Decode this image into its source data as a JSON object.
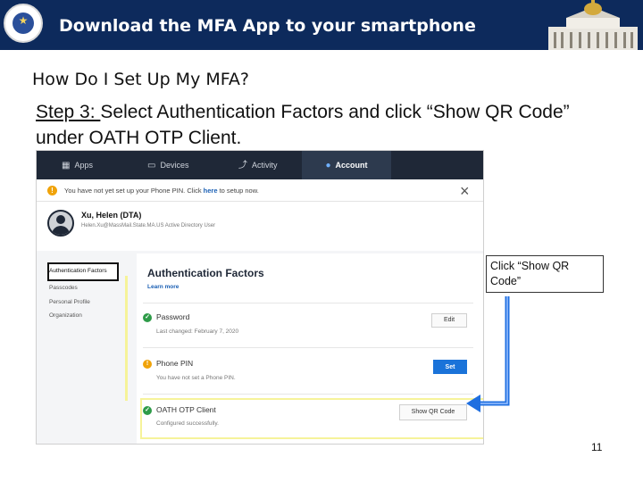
{
  "header": {
    "title": "Download the MFA App to your smartphone",
    "seal_icon": "massachusetts-seal-icon",
    "building_icon": "state-house-icon",
    "color": "#0d2a5c"
  },
  "slide": {
    "subtitle": "How Do I Set Up My MFA?",
    "step_label": "Step 3: ",
    "step_text": " Select Authentication Factors and click “Show QR Code” under OATH OTP Client.",
    "callout": "Click “Show QR Code”",
    "page_number": "11"
  },
  "screenshot": {
    "nav": [
      {
        "label": "Apps",
        "icon": "grid-icon"
      },
      {
        "label": "Devices",
        "icon": "devices-icon"
      },
      {
        "label": "Activity",
        "icon": "activity-icon"
      },
      {
        "label": "Account",
        "icon": "user-icon"
      }
    ],
    "alert": {
      "prefix": "You have not yet set up your Phone PIN. Click ",
      "link": "here",
      "suffix": " to setup now."
    },
    "user": {
      "name": "Xu, Helen (DTA)",
      "meta": "Helen.Xu@MassMail.State.MA.US   Active Directory User"
    },
    "sidebar": [
      "Authentication Factors",
      "Passcodes",
      "Personal Profile",
      "Organization"
    ],
    "card": {
      "title": "Authentication Factors",
      "link": "Learn more",
      "factors": [
        {
          "name": "Password",
          "sub": "Last changed: February 7, 2020",
          "button": "Edit",
          "status": "ok"
        },
        {
          "name": "Phone PIN",
          "sub": "You have not set a Phone PIN.",
          "button": "Set",
          "status": "warning"
        },
        {
          "name": "OATH OTP Client",
          "sub": "Configured successfully.",
          "button": "Show QR Code",
          "status": "ok"
        }
      ]
    }
  },
  "colors": {
    "accent_blue": "#1a73d9",
    "success_green": "#2e9b48",
    "warning_orange": "#f0a30a",
    "arrow_blue": "#1f6fe0",
    "highlight_yellow": "#f6f39a"
  }
}
